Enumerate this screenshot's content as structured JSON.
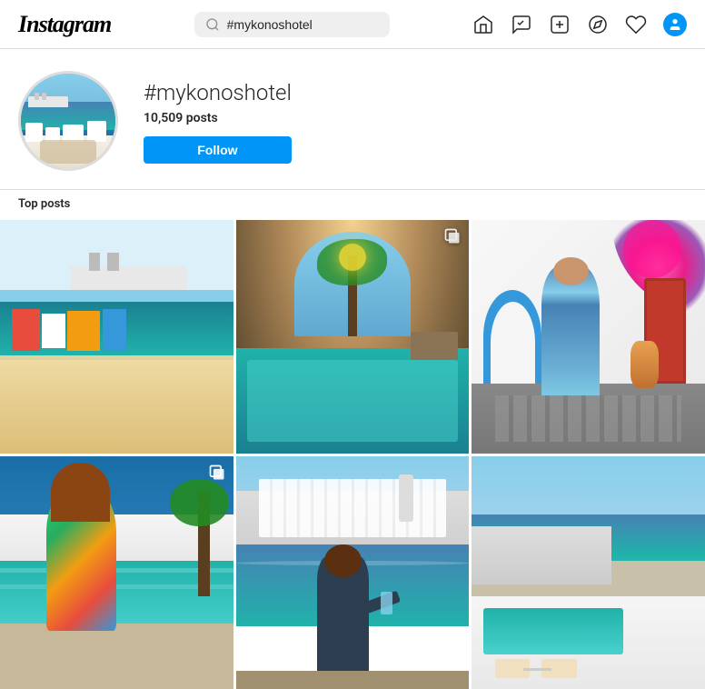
{
  "header": {
    "logo": "Instagram",
    "search": {
      "placeholder": "#mykonoshotel",
      "value": "#mykonoshotel"
    },
    "nav": {
      "home_label": "home",
      "messenger_label": "messenger",
      "create_label": "create",
      "explore_label": "explore",
      "likes_label": "likes",
      "profile_label": "profile"
    }
  },
  "profile": {
    "hashtag": "#mykonoshotel",
    "posts_count": "10,509",
    "posts_label": "posts",
    "follow_label": "Follow"
  },
  "top_posts": {
    "section_label": "Top posts"
  },
  "posts": [
    {
      "id": 1,
      "alt": "Mykonos waterfront restaurant with cruise ship",
      "multi": false
    },
    {
      "id": 2,
      "alt": "Cave pool with palm tree in Mykonos hotel",
      "multi": true
    },
    {
      "id": 3,
      "alt": "Woman in blue dress in Mykonos alley with flowers",
      "multi": false
    },
    {
      "id": 4,
      "alt": "Mykonos hotel pool with ocean view and person",
      "multi": true
    },
    {
      "id": 5,
      "alt": "Mykonos town view from water",
      "multi": false
    },
    {
      "id": 6,
      "alt": "Mykonos aerial view with infinity pool",
      "multi": false
    }
  ]
}
